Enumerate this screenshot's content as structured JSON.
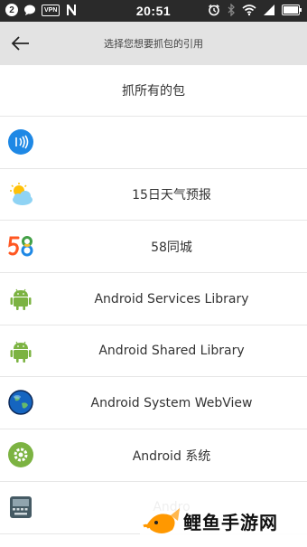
{
  "status_bar": {
    "time": "20:51",
    "notification_count": "2",
    "vpn_label": "VPN"
  },
  "app_bar": {
    "title": "选择您想要抓包的引用"
  },
  "list": {
    "header": "抓所有的包",
    "items": [
      {
        "label": "",
        "icon": "nfc-icon"
      },
      {
        "label": "15日天气预报",
        "icon": "weather-icon"
      },
      {
        "label": "58同城",
        "icon": "58-logo-icon"
      },
      {
        "label": "Android Services Library",
        "icon": "android-icon"
      },
      {
        "label": "Android Shared Library",
        "icon": "android-icon"
      },
      {
        "label": "Android System WebView",
        "icon": "globe-icon"
      },
      {
        "label": "Android 系统",
        "icon": "settings-gear-icon"
      },
      {
        "label": "Andro",
        "icon": "keyboard-icon"
      }
    ]
  },
  "watermark": {
    "text": "鲤鱼手游网"
  },
  "colors": {
    "status_bar": "#2a2a2a",
    "app_bar": "#e3e3e3",
    "android_green": "#7cb342",
    "nfc_blue": "#1e88e5"
  }
}
